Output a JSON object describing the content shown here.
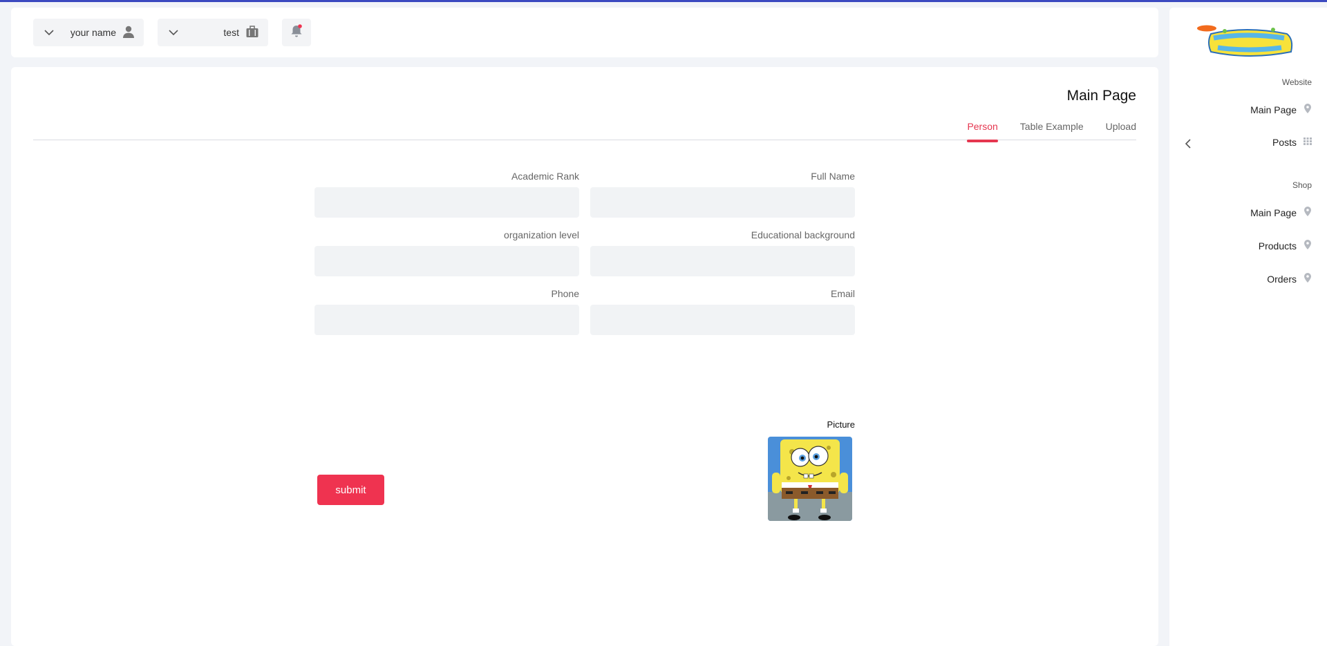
{
  "header": {
    "user_name": "your name",
    "workspace": "test"
  },
  "main": {
    "title": "Main Page",
    "tabs": [
      {
        "label": "Person",
        "active": true
      },
      {
        "label": "Table Example",
        "active": false
      },
      {
        "label": "Upload",
        "active": false
      }
    ],
    "form": {
      "academic_rank": {
        "label": "Academic Rank",
        "value": ""
      },
      "full_name": {
        "label": "Full Name",
        "value": ""
      },
      "organization_level": {
        "label": "organization level",
        "value": ""
      },
      "educational_background": {
        "label": "Educational background",
        "value": ""
      },
      "phone": {
        "label": "Phone",
        "value": ""
      },
      "email": {
        "label": "Email",
        "value": ""
      },
      "picture_label": "Picture",
      "submit_label": "submit"
    }
  },
  "sidebar": {
    "sections": [
      {
        "heading": "Website",
        "items": [
          "Main Page",
          "Posts"
        ]
      },
      {
        "heading": "Shop",
        "items": [
          "Main Page",
          "Products",
          "Orders"
        ]
      }
    ]
  },
  "colors": {
    "accent": "#ef3350",
    "top_border": "#3b49c0",
    "field_bg": "#f1f3f5"
  },
  "icons": {
    "user": "user-icon",
    "workspace": "briefcase-icon",
    "notifications": "bell-icon",
    "nav_location": "location-pin-icon",
    "nav_posts": "grid-icon",
    "collapse": "chevron-left-icon"
  }
}
